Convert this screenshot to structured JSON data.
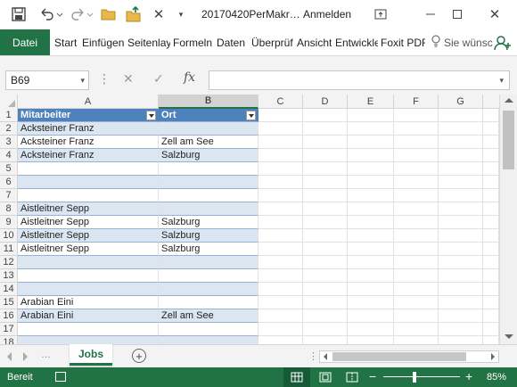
{
  "titlebar": {
    "filename": "20170420PerMakr…",
    "signin": "Anmelden"
  },
  "ribbon": {
    "file_tab": "Datei",
    "tabs": [
      "Start",
      "Einfügen",
      "Seitenlay",
      "Formeln",
      "Daten",
      "Überprüf",
      "Ansicht",
      "Entwickle",
      "Foxit PDF"
    ],
    "search_placeholder": "Sie wünsc"
  },
  "formula_bar": {
    "name_box": "B69",
    "fx_label": "fx",
    "formula": ""
  },
  "columns": [
    "A",
    "B",
    "C",
    "D",
    "E",
    "F",
    "G"
  ],
  "selected_column": "B",
  "table": {
    "headers": [
      "Mitarbeiter",
      "Ort"
    ],
    "rows": [
      {
        "n": "1",
        "a": "Mitarbeiter",
        "b": "Ort"
      },
      {
        "n": "2",
        "a": "Acksteiner Franz",
        "b": ""
      },
      {
        "n": "3",
        "a": "Acksteiner Franz",
        "b": "Zell am See"
      },
      {
        "n": "4",
        "a": "Acksteiner Franz",
        "b": "Salzburg"
      },
      {
        "n": "5",
        "a": "",
        "b": ""
      },
      {
        "n": "6",
        "a": "",
        "b": ""
      },
      {
        "n": "7",
        "a": "",
        "b": ""
      },
      {
        "n": "8",
        "a": "Aistleitner Sepp",
        "b": ""
      },
      {
        "n": "9",
        "a": "Aistleitner Sepp",
        "b": "Salzburg"
      },
      {
        "n": "10",
        "a": "Aistleitner Sepp",
        "b": "Salzburg"
      },
      {
        "n": "11",
        "a": "Aistleitner Sepp",
        "b": "Salzburg"
      },
      {
        "n": "12",
        "a": "",
        "b": ""
      },
      {
        "n": "13",
        "a": "",
        "b": ""
      },
      {
        "n": "14",
        "a": "",
        "b": ""
      },
      {
        "n": "15",
        "a": "Arabian Eini",
        "b": ""
      },
      {
        "n": "16",
        "a": "Arabian Eini",
        "b": "Zell am See"
      },
      {
        "n": "17",
        "a": "",
        "b": ""
      },
      {
        "n": "18",
        "a": "",
        "b": ""
      }
    ]
  },
  "sheets": {
    "active": "Jobs",
    "add_label": "+"
  },
  "statusbar": {
    "status": "Bereit",
    "zoom": "85%"
  },
  "colors": {
    "accent": "#217346",
    "table_header": "#4f81bd",
    "table_band": "#dce6f1"
  }
}
